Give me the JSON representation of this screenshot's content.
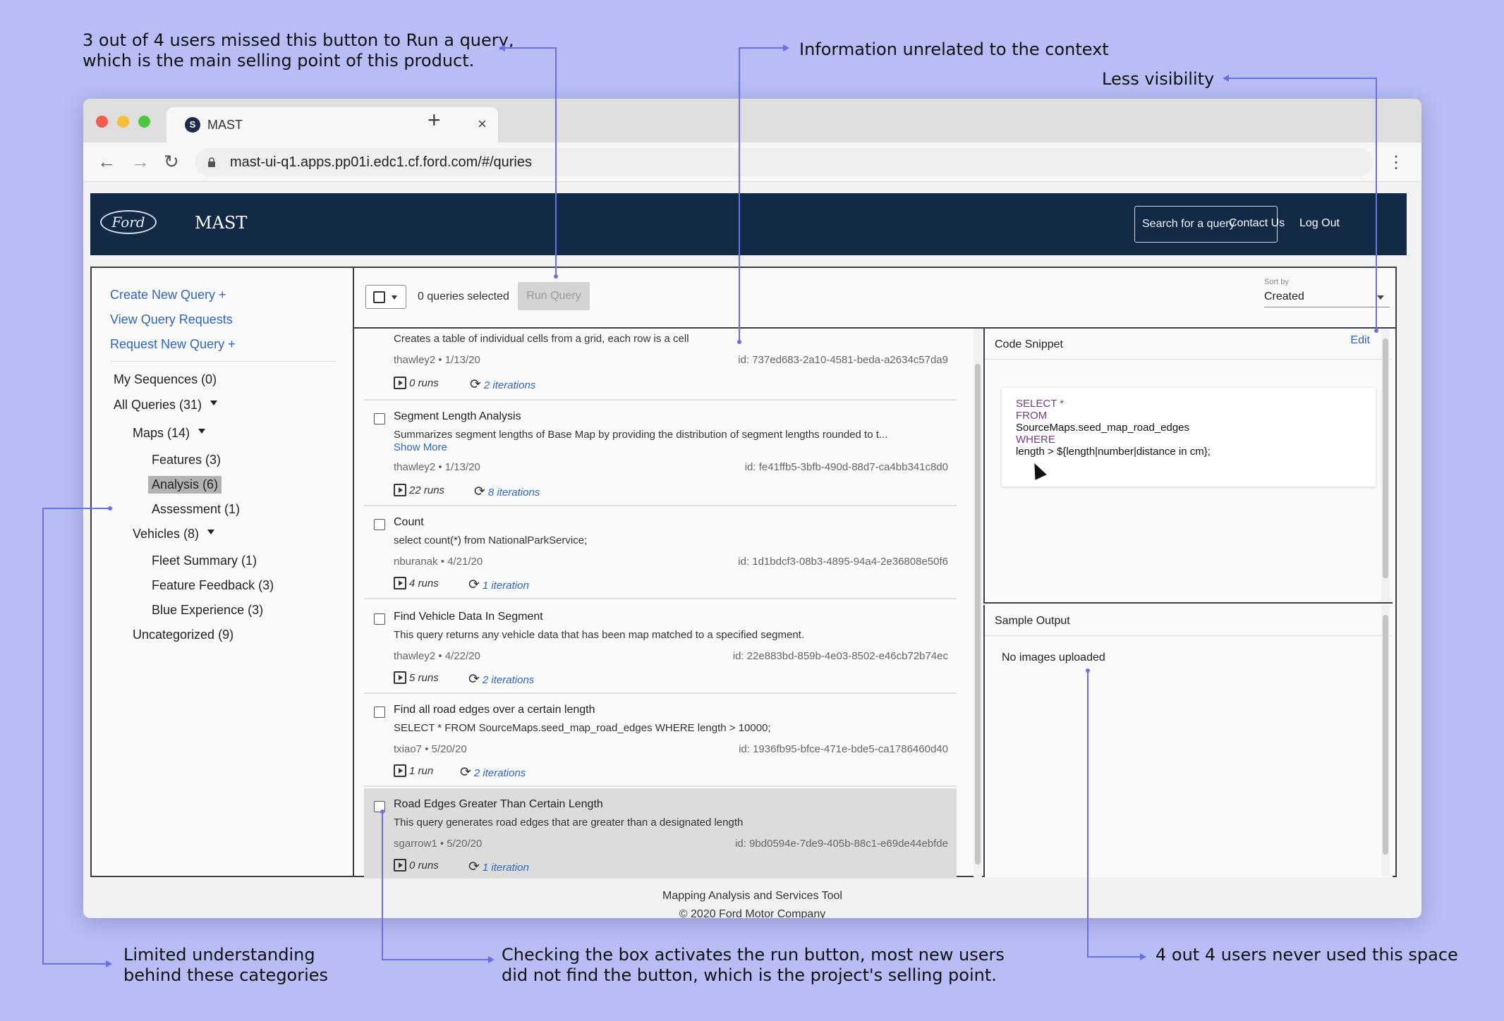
{
  "annotations": {
    "run_button": [
      "3 out of 4 users missed this button to Run a query,",
      "which is the main selling point of this product."
    ],
    "unrelated": "Information unrelated to the context",
    "visibility": "Less visibility",
    "categories": [
      "Limited understanding",
      "behind these categories"
    ],
    "checkbox": [
      "Checking the box activates the run button, most new users",
      "did not find the button, which is the project's selling point."
    ],
    "space": "4 out 4 users never used this space"
  },
  "browser": {
    "tab_title": "MAST",
    "url": "mast-ui-q1.apps.pp01i.edc1.cf.ford.com/#/quries"
  },
  "header": {
    "logo": "Ford",
    "brand": "MAST",
    "search_placeholder": "Search for a query",
    "contact": "Contact Us",
    "logout": "Log Out"
  },
  "sidebar": {
    "links": [
      "Create New Query +",
      "View Query Requests",
      "Request New Query +"
    ],
    "my_sequences": "My Sequences (0)",
    "all_queries": "All Queries (31)",
    "maps": "Maps (14)",
    "features": "Features (3)",
    "analysis": "Analysis (6)",
    "assessment": "Assessment (1)",
    "vehicles": "Vehicles (8)",
    "fleet_summary": "Fleet Summary (1)",
    "feature_feedback": "Feature Feedback (3)",
    "blue_experience": "Blue Experience (3)",
    "uncategorized": "Uncategorized (9)"
  },
  "toolbar": {
    "selected_count": "0 queries selected",
    "run_label": "Run Query",
    "sort_label": "Sort by",
    "sort_value": "Created"
  },
  "queries": [
    {
      "title": "",
      "desc": "Creates a table of individual cells from a grid, each row is a cell",
      "more": "",
      "meta": "thawley2  •  1/13/20",
      "id": "id: 737ed683-2a10-4581-beda-a2634c57da9",
      "runs": "0 runs",
      "iters": "2 iterations"
    },
    {
      "title": "Segment Length Analysis",
      "desc": "Summarizes segment lengths of Base Map by providing the distribution of segment lengths rounded to t...",
      "more": "Show More",
      "meta": "thawley2  •  1/13/20",
      "id": "id: fe41ffb5-3bfb-490d-88d7-ca4bb341c8d0",
      "runs": "22 runs",
      "iters": "8 iterations"
    },
    {
      "title": "Count",
      "desc": "select count(*) from NationalParkService;",
      "more": "",
      "meta": "nburanak  •  4/21/20",
      "id": "id: 1d1bdcf3-08b3-4895-94a4-2e36808e50f6",
      "runs": "4 runs",
      "iters": "1 iteration"
    },
    {
      "title": "Find Vehicle Data In Segment",
      "desc": "This query returns any vehicle data that has been map matched to a specified segment.",
      "more": "",
      "meta": "thawley2  •  4/22/20",
      "id": "id: 22e883bd-859b-4e03-8502-e46cb72b74ec",
      "runs": "5 runs",
      "iters": "2 iterations"
    },
    {
      "title": "Find all road edges over a certain length",
      "desc": "SELECT * FROM SourceMaps.seed_map_road_edges WHERE length > 10000;",
      "more": "",
      "meta": "txiao7  •  5/20/20",
      "id": "id: 1936fb95-bfce-471e-bde5-ca1786460d40",
      "runs": "1 run",
      "iters": "2 iterations"
    },
    {
      "title": "Road Edges Greater Than Certain Length",
      "desc": "This query generates road edges that are greater than a designated length",
      "more": "",
      "meta": "sgarrow1  •  5/20/20",
      "id": "id: 9bd0594e-7de9-405b-88c1-e69de44ebfde",
      "runs": "0 runs",
      "iters": "1 iteration"
    }
  ],
  "code_panel": {
    "title": "Code Snippet",
    "edit": "Edit",
    "lines": [
      "SELECT *",
      "FROM",
      "SourceMaps.seed_map_road_edges",
      "WHERE",
      "length > ${length|number|distance in cm};"
    ]
  },
  "output_panel": {
    "title": "Sample Output",
    "empty": "No images uploaded"
  },
  "footer": {
    "line1": "Mapping Analysis and Services Tool",
    "line2": "© 2020 Ford Motor Company"
  }
}
